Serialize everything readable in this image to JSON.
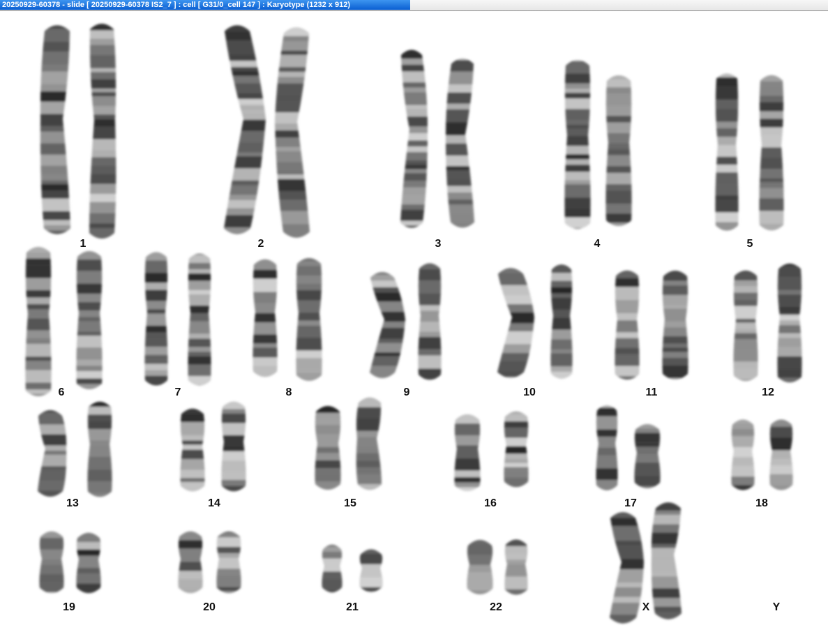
{
  "window": {
    "title": "20250929-60378 - slide [ 20250929-60378 IS2_7 ] : cell [ G31/0_cell 147 ] : Karyotype  (1232 x 912)"
  },
  "karyotype": {
    "pairs": [
      {
        "label": "1",
        "count": 2
      },
      {
        "label": "2",
        "count": 2
      },
      {
        "label": "3",
        "count": 2
      },
      {
        "label": "4",
        "count": 2
      },
      {
        "label": "5",
        "count": 2
      },
      {
        "label": "6",
        "count": 2
      },
      {
        "label": "7",
        "count": 2
      },
      {
        "label": "8",
        "count": 2
      },
      {
        "label": "9",
        "count": 2
      },
      {
        "label": "10",
        "count": 2
      },
      {
        "label": "11",
        "count": 2
      },
      {
        "label": "12",
        "count": 2
      },
      {
        "label": "13",
        "count": 2
      },
      {
        "label": "14",
        "count": 2
      },
      {
        "label": "15",
        "count": 2
      },
      {
        "label": "16",
        "count": 2
      },
      {
        "label": "17",
        "count": 2
      },
      {
        "label": "18",
        "count": 2
      },
      {
        "label": "19",
        "count": 2
      },
      {
        "label": "20",
        "count": 2
      },
      {
        "label": "21",
        "count": 2
      },
      {
        "label": "22",
        "count": 2
      },
      {
        "label": "X",
        "count": 2
      },
      {
        "label": "Y",
        "count": 0
      }
    ]
  }
}
